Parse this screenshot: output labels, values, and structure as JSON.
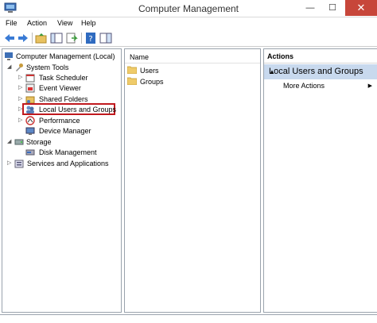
{
  "window": {
    "title": "Computer Management",
    "minimize_glyph": "—",
    "maximize_glyph": "☐",
    "close_glyph": "✕"
  },
  "menu": [
    "File",
    "Action",
    "View",
    "Help"
  ],
  "toolbar": {
    "icons": [
      "back-arrow-icon",
      "forward-arrow-icon",
      "up-folder-icon",
      "show-hide-tree-icon",
      "export-list-icon",
      "help-icon",
      "show-hide-action-pane-icon"
    ]
  },
  "tree": {
    "items": [
      {
        "label": "Computer Management (Local)",
        "icon": "computer-management-icon",
        "expander": ""
      },
      {
        "label": "System Tools",
        "icon": "system-tools-icon",
        "expander": "◢"
      },
      {
        "label": "Task Scheduler",
        "icon": "task-scheduler-icon",
        "expander": "▷"
      },
      {
        "label": "Event Viewer",
        "icon": "event-viewer-icon",
        "expander": "▷"
      },
      {
        "label": "Shared Folders",
        "icon": "shared-folders-icon",
        "expander": "▷"
      },
      {
        "label": "Local Users and Groups",
        "icon": "local-users-groups-icon",
        "expander": "▷"
      },
      {
        "label": "Performance",
        "icon": "performance-icon",
        "expander": "▷"
      },
      {
        "label": "Device Manager",
        "icon": "device-manager-icon",
        "expander": ""
      },
      {
        "label": "Storage",
        "icon": "storage-icon",
        "expander": "◢"
      },
      {
        "label": "Disk Management",
        "icon": "disk-management-icon",
        "expander": ""
      },
      {
        "label": "Services and Applications",
        "icon": "services-applications-icon",
        "expander": "▷"
      }
    ],
    "selected": "Local Users and Groups"
  },
  "list": {
    "column_header": "Name",
    "rows": [
      {
        "label": "Users",
        "icon": "folder-icon"
      },
      {
        "label": "Groups",
        "icon": "folder-icon"
      }
    ]
  },
  "actions": {
    "header": "Actions",
    "section_title": "Local Users and Groups",
    "section_caret": "▲",
    "items": [
      {
        "label": "More Actions",
        "arrow": "▶"
      }
    ]
  },
  "colors": {
    "selection_outline": "#c0191e",
    "action_section_bg": "#c8d9ee",
    "close_button": "#c7463a"
  }
}
